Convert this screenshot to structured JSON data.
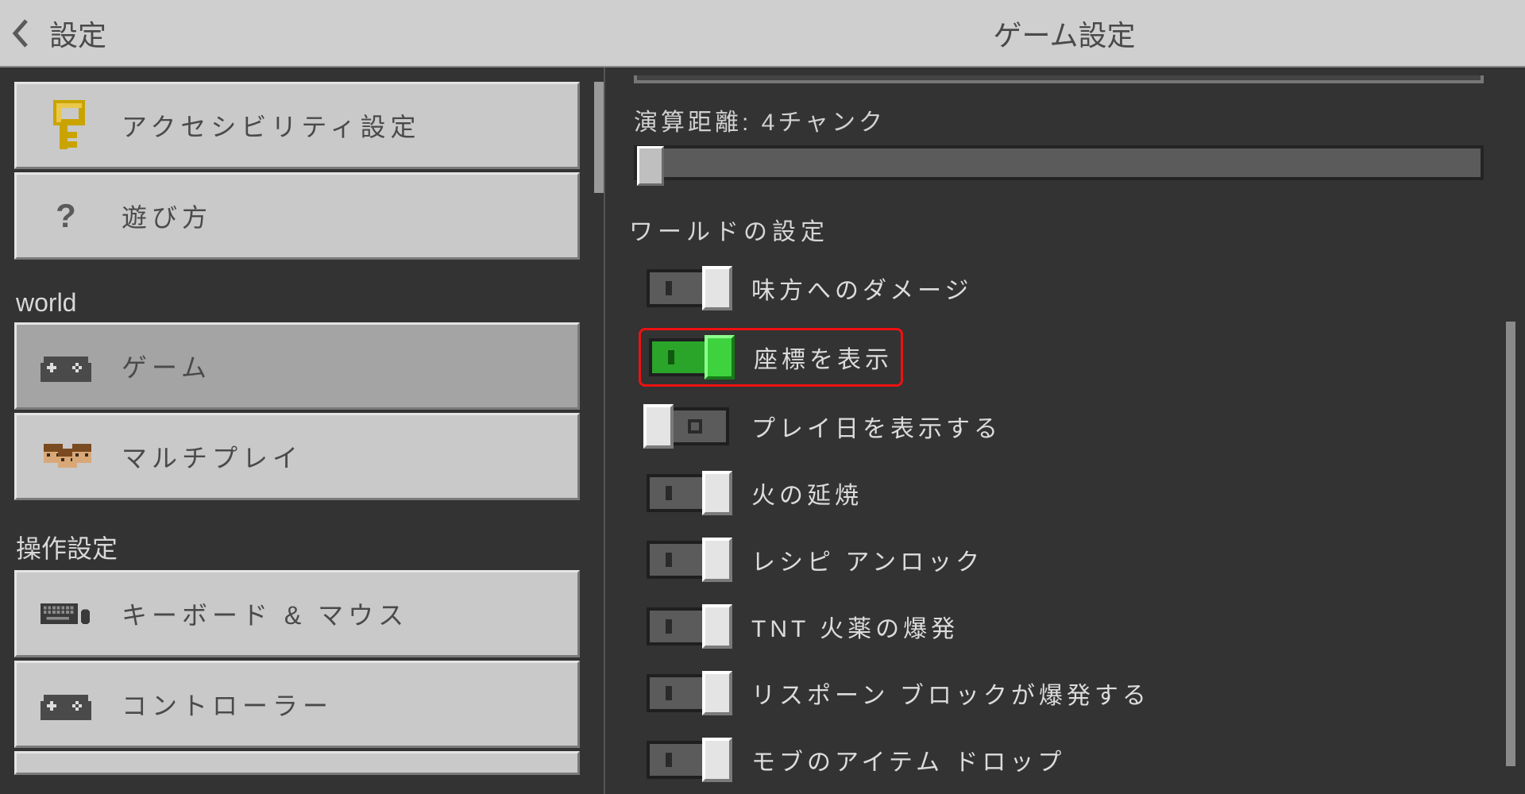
{
  "titlebar": {
    "back_label": "設定",
    "title": "ゲーム設定"
  },
  "sidebar": {
    "group1": [
      {
        "icon": "key",
        "label": "アクセシビリティ設定"
      },
      {
        "icon": "question",
        "label": "遊び方"
      }
    ],
    "group2_label": "world",
    "group2": [
      {
        "icon": "controller",
        "label": "ゲーム",
        "selected": true
      },
      {
        "icon": "players",
        "label": "マルチプレイ"
      }
    ],
    "group3_label": "操作設定",
    "group3": [
      {
        "icon": "keyboard",
        "label": "キーボード & マウス"
      },
      {
        "icon": "controller",
        "label": "コントローラー"
      }
    ]
  },
  "main": {
    "slider_label": "演算距離: 4チャンク",
    "section_title": "ワールドの設定",
    "toggles": [
      {
        "label": "味方へのダメージ",
        "state": "off"
      },
      {
        "label": "座標を表示",
        "state": "on",
        "highlight": true
      },
      {
        "label": "プレイ日を表示する",
        "state": "locked"
      },
      {
        "label": "火の延焼",
        "state": "off"
      },
      {
        "label": "レシピ アンロック",
        "state": "off"
      },
      {
        "label": "TNT 火薬の爆発",
        "state": "off"
      },
      {
        "label": "リスポーン ブロックが爆発する",
        "state": "off"
      },
      {
        "label": "モブのアイテム ドロップ",
        "state": "off"
      }
    ]
  }
}
